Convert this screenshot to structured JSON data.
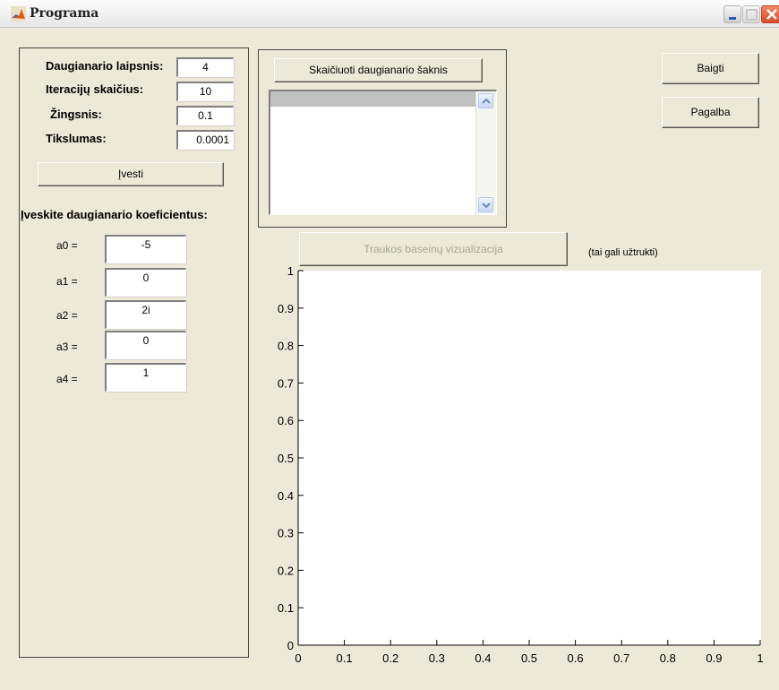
{
  "window": {
    "title": "Programa"
  },
  "params": {
    "degree_label": "Daugianario laipsnis:",
    "degree_value": "4",
    "iterations_label": "Iteracijų skaičius:",
    "iterations_value": "10",
    "step_label": "Žingsnis:",
    "step_value": "0.1",
    "precision_label": "Tikslumas:",
    "precision_value": "0.0001",
    "enter_button": "Įvesti",
    "coef_header": "Įveskite daugianario koeficientus:",
    "coefficients": [
      {
        "label": "a0 =",
        "value": "-5"
      },
      {
        "label": "a1 =",
        "value": "0"
      },
      {
        "label": "a2 =",
        "value": "2i"
      },
      {
        "label": "a3 =",
        "value": "0"
      },
      {
        "label": "a4 =",
        "value": "1"
      }
    ]
  },
  "roots": {
    "compute_button": "Skaičiuoti daugianario šaknis",
    "items": []
  },
  "actions": {
    "exit_button": "Baigti",
    "help_button": "Pagalba"
  },
  "visualization": {
    "button": "Traukos baseinų vizualizacija",
    "note": "(tai gali užtrukti)"
  },
  "chart_data": {
    "type": "scatter",
    "title": "",
    "xlabel": "",
    "ylabel": "",
    "xlim": [
      0,
      1
    ],
    "ylim": [
      0,
      1
    ],
    "xticks": [
      "0",
      "0.1",
      "0.2",
      "0.3",
      "0.4",
      "0.5",
      "0.6",
      "0.7",
      "0.8",
      "0.9",
      "1"
    ],
    "yticks": [
      "0",
      "0.1",
      "0.2",
      "0.3",
      "0.4",
      "0.5",
      "0.6",
      "0.7",
      "0.8",
      "0.9",
      "1"
    ],
    "series": []
  }
}
